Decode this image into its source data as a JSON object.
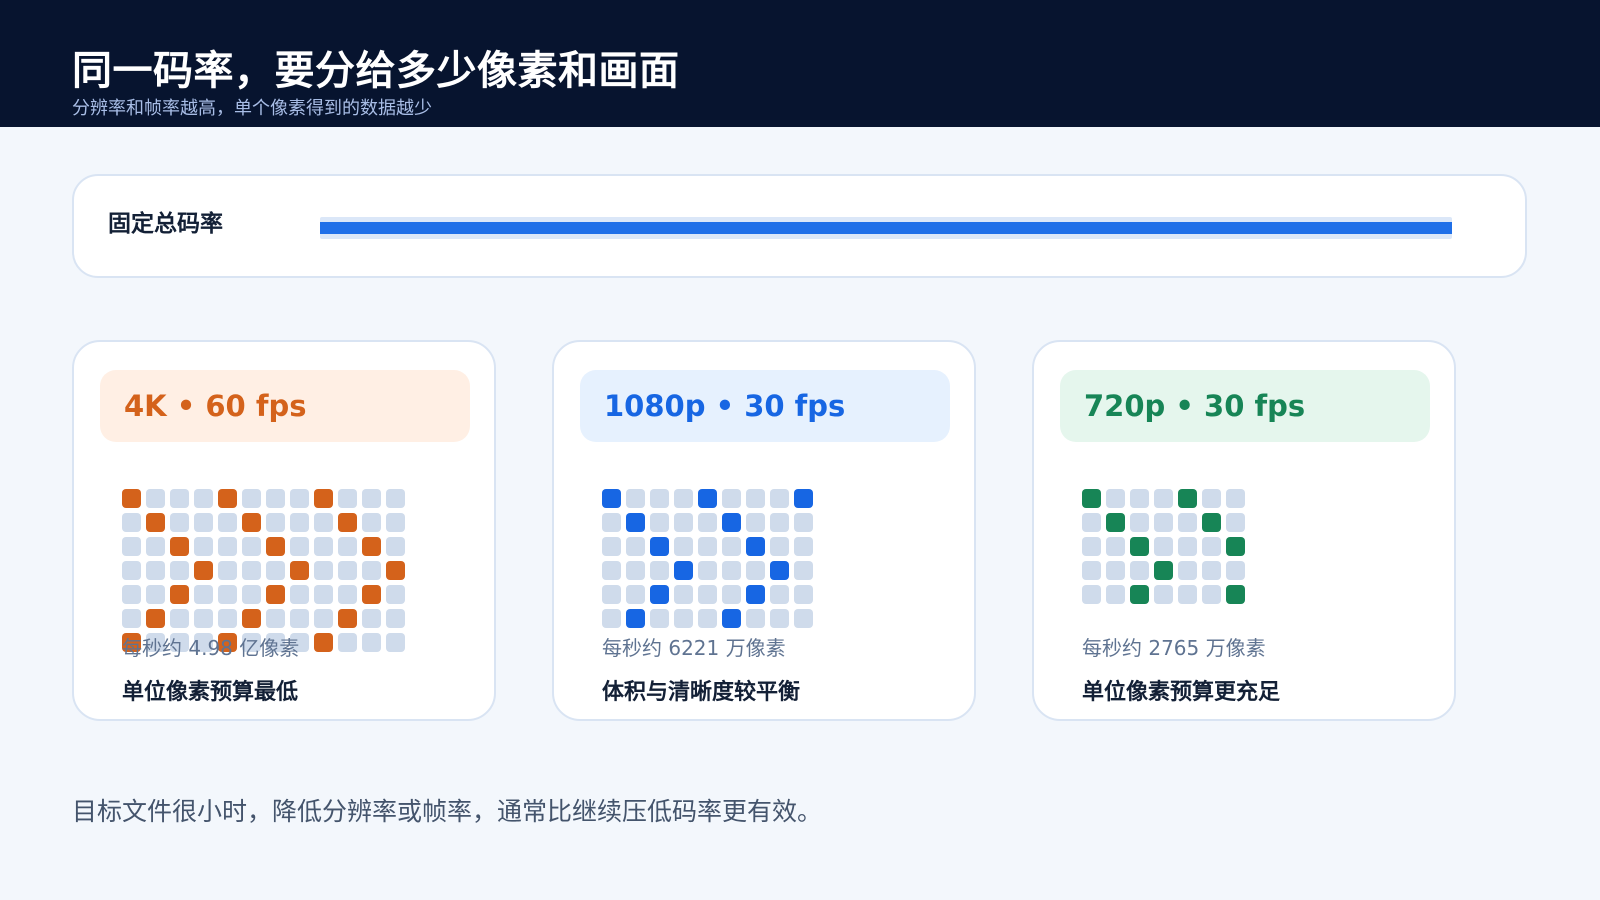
{
  "header": {
    "title": "同一码率，要分给多少像素和画面",
    "subtitle": "分辨率和帧率越高，单个像素得到的数据越少"
  },
  "bitrate": {
    "label": "固定总码率",
    "fill_fraction": 1.0,
    "color": "#1f6fe8"
  },
  "cards": [
    {
      "title": "4K • 60 fps",
      "count_text": "每秒约 4.98 亿像素",
      "note": "单位像素预算最低",
      "accent": "#d4621b",
      "head_bg": "#ffefe4",
      "grid": {
        "cols": 12,
        "rows": 7
      }
    },
    {
      "title": "1080p • 30 fps",
      "count_text": "每秒约 6221 万像素",
      "note": "体积与清晰度较平衡",
      "accent": "#1766e3",
      "head_bg": "#e6f1fe",
      "grid": {
        "cols": 9,
        "rows": 6
      }
    },
    {
      "title": "720p • 30 fps",
      "count_text": "每秒约 2765 万像素",
      "note": "单位像素预算更充足",
      "accent": "#178556",
      "head_bg": "#e5f6ed",
      "grid": {
        "cols": 7,
        "rows": 5
      }
    }
  ],
  "footer": {
    "note": "目标文件很小时，降低分辨率或帧率，通常比继续压低码率更有效。"
  }
}
